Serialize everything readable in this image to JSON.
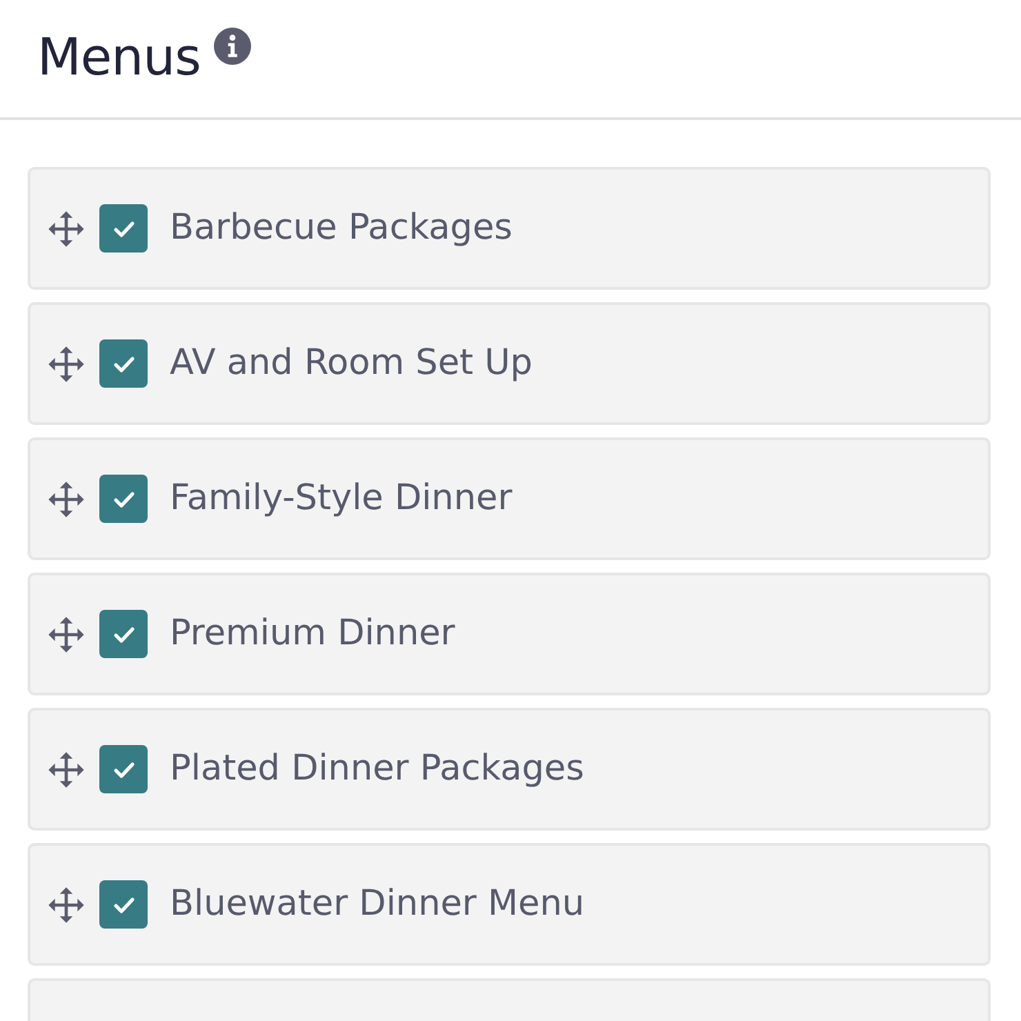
{
  "header": {
    "title": "Menus"
  },
  "menus": [
    {
      "label": "Barbecue Packages",
      "checked": true
    },
    {
      "label": "AV and Room Set Up",
      "checked": true
    },
    {
      "label": "Family-Style Dinner",
      "checked": true
    },
    {
      "label": "Premium Dinner",
      "checked": true
    },
    {
      "label": "Plated Dinner Packages",
      "checked": true
    },
    {
      "label": "Bluewater Dinner Menu",
      "checked": true
    }
  ]
}
